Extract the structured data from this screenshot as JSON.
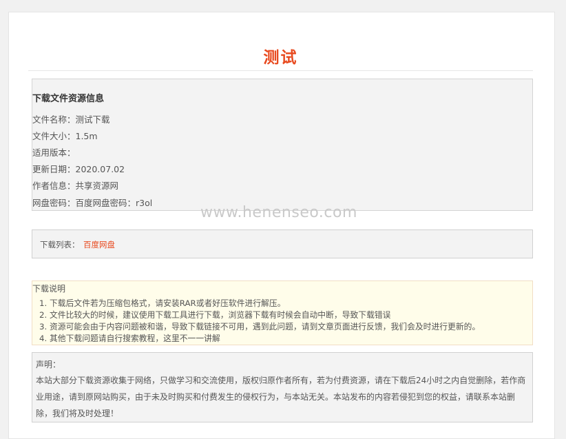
{
  "article": {
    "title": "测试"
  },
  "resource_info": {
    "heading": "下载文件资源信息",
    "rows": [
      {
        "text": "文件名称：测试下载"
      },
      {
        "text": "文件大小：1.5m"
      },
      {
        "text": "适用版本："
      },
      {
        "text": "更新日期：2020.07.02"
      },
      {
        "text": "作者信息：共享资源网"
      },
      {
        "text": "网盘密码：百度网盘密码：r3ol"
      }
    ]
  },
  "watermark": "www.henenseo.com",
  "download_list": {
    "label": "下载列表：",
    "link_text": "百度网盘",
    "link_color": "#e84a1f"
  },
  "download_notes": {
    "title": "下载说明",
    "items": [
      "1. 下载后文件若为压缩包格式，请安装RAR或者好压软件进行解压。",
      "2. 文件比较大的时候，建议使用下载工具进行下载，浏览器下载有时候会自动中断，导致下载错误",
      "3. 资源可能会由于内容问题被和谐，导致下载链接不可用，遇到此问题，请到文章页面进行反馈，我们会及时进行更新的。",
      "4. 其他下载问题请自行搜索教程，这里不一一讲解"
    ]
  },
  "declaration": {
    "title": "声明：",
    "text": "本站大部分下载资源收集于网络，只做学习和交流使用，版权归原作者所有，若为付费资源，请在下载后24小时之内自觉删除，若作商业用途，请到原网站购买，由于未及时购买和付费发生的侵权行为，与本站无关。本站发布的内容若侵犯到您的权益，请联系本站删除，我们将及时处理！"
  },
  "colors": {
    "accent": "#e84a1f",
    "note_background": "#fffdea"
  }
}
